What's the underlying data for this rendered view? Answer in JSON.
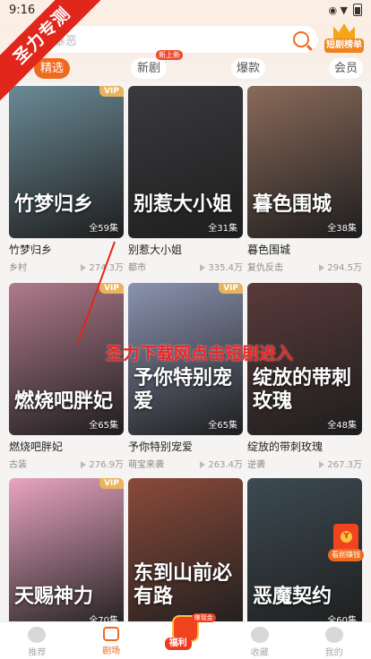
{
  "status": {
    "time": "9:16",
    "icons": "◉ ▼"
  },
  "watermark_corner": "圣力专测",
  "overlay_watermark": "圣力下载网点击短剧进入",
  "search": {
    "placeholder": "暴恶"
  },
  "ranking_badge": "短剧榜单",
  "tabs": [
    {
      "label": "精选",
      "active": true
    },
    {
      "label": "新剧",
      "tag": "新上新"
    },
    {
      "label": "爆款"
    },
    {
      "label": "会员"
    }
  ],
  "cards": [
    {
      "title": "竹梦归乡",
      "cover_title": "竹梦归乡",
      "tag": "乡村",
      "views": "274.3万",
      "episodes": "全59集",
      "vip": "VIP",
      "color": "#6b8a96"
    },
    {
      "title": "别惹大小姐",
      "cover_title": "别惹大小姐",
      "tag": "都市",
      "views": "335.4万",
      "episodes": "全31集",
      "vip": "",
      "color": "#3a3a3e"
    },
    {
      "title": "暮色围城",
      "cover_title": "暮色围城",
      "tag": "复仇反击",
      "views": "294.5万",
      "episodes": "全38集",
      "vip": "",
      "color": "#8a6a5a"
    },
    {
      "title": "燃烧吧胖妃",
      "cover_title": "燃烧吧胖妃",
      "tag": "古装",
      "views": "276.9万",
      "episodes": "全65集",
      "vip": "VIP",
      "color": "#b07a8c"
    },
    {
      "title": "予你特别宠爱",
      "cover_title": "予你特别宠爱",
      "tag": "萌宝来袭",
      "views": "263.4万",
      "episodes": "全65集",
      "vip": "VIP",
      "color": "#8a93b0"
    },
    {
      "title": "绽放的带刺玫瑰",
      "cover_title": "绽放的带刺玫瑰",
      "tag": "逆袭",
      "views": "267.3万",
      "episodes": "全48集",
      "vip": "",
      "color": "#5a3a3a"
    },
    {
      "title": "",
      "cover_title": "天赐神力",
      "tag": "",
      "views": "",
      "episodes": "全70集",
      "vip": "VIP",
      "color": "#e9a4c0"
    },
    {
      "title": "",
      "cover_title": "东到山前必有路",
      "tag": "",
      "views": "",
      "episodes": "",
      "vip": "",
      "color": "#8a4a3a"
    },
    {
      "title": "",
      "cover_title": "恶魔契约",
      "tag": "",
      "views": "",
      "episodes": "全60集",
      "vip": "",
      "color": "#3c4a52"
    }
  ],
  "reward_float": "看剧赚钱",
  "bottom_nav": [
    {
      "label": "推荐",
      "icon": "play-circle-icon"
    },
    {
      "label": "剧场",
      "icon": "theater-icon",
      "active": true
    },
    {
      "label": "福利",
      "icon": "gift-icon",
      "badge": "赚现金"
    },
    {
      "label": "收藏",
      "icon": "star-icon"
    },
    {
      "label": "我的",
      "icon": "user-icon"
    }
  ]
}
